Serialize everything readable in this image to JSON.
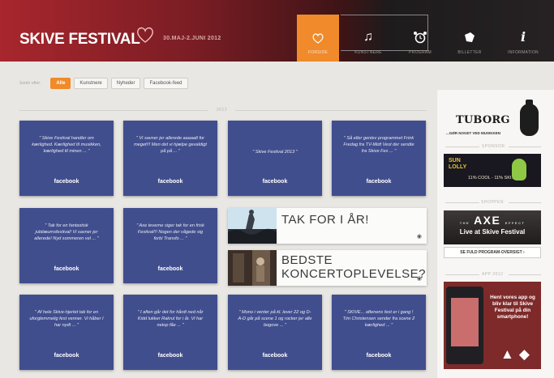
{
  "header": {
    "brand": "SKIVE FESTIVAL",
    "dates": "30.MAJ-2.JUNI 2012",
    "nav": [
      {
        "label": "FORSIDE",
        "icon": "heart-icon"
      },
      {
        "label": "KUNSTNERE",
        "icon": "music-note-icon"
      },
      {
        "label": "PROGRAM",
        "icon": "alarm-clock-icon"
      },
      {
        "label": "BILLETTER",
        "icon": "ticket-icon"
      },
      {
        "label": "INFORMATION",
        "icon": "info-icon"
      }
    ]
  },
  "filters": {
    "label": "Sortér efter:",
    "options": [
      "Alle",
      "Kunstnere",
      "Nyheder",
      "Facebook-feed"
    ]
  },
  "sections": {
    "main": "2012",
    "sponsor": "SPONSOR",
    "shoppen": "SHOPPEN",
    "app": "APP 2012"
  },
  "tiles": [
    {
      "quote": "\" Skive Festival handler om kærlighed. Kærlighed til musikken, kærlighed til minen ... \"",
      "source": "facebook"
    },
    {
      "quote": "\" Vi savner jer allerede aaaaalt for meget!!! Men det vi hjælpe gevaldigt på på ... \"",
      "source": "facebook"
    },
    {
      "quote": "\" Skive Festival 2013 \"",
      "source": "facebook"
    },
    {
      "quote": "\" Så eller genlev programmet Frink Fredag fra TV-Midt Vest der sendte fra Skive Fes ... \"",
      "source": "facebook"
    },
    {
      "quote": "\" Tak for en fantastisk jubilæumsfestival! Vi savner jer allerede! Nyd sommeren vel ... \"",
      "source": "facebook"
    },
    {
      "quote": "\" Axe teverne siger tak for en frisk Festival!!! Nogen der vågede sig forbi Transfo ... \"",
      "source": "facebook"
    },
    {
      "quote": "\" Af hele Skive-hjertet tak for en uforglemmelig fest venner. Vi håber I har nydt ... \"",
      "source": "facebook"
    },
    {
      "quote": "\" I aften går det for hårdt ned når Kidd lukker Rakrul for i år. Vi har netop fåe ... \"",
      "source": "facebook"
    },
    {
      "quote": "\" Mono i venter på kl. lever 22 og D-A-D går på scene 1 og rocker jer alle bogove ... \"",
      "source": "facebook"
    },
    {
      "quote": "\" SKIVE... aftenens fest er i gang ! Tim Christensen sender fra scene 2 kærlighed ... \"",
      "source": "facebook"
    }
  ],
  "news": [
    {
      "title": "TAK FOR I ÅR!",
      "icon": "rss-icon"
    },
    {
      "title_line1": "BEDSTE",
      "title_line2": "KONCERTOPLEVELSE?",
      "icon": "rss-icon"
    }
  ],
  "sidebar": {
    "tuborg": "TUBORG",
    "tuborg_tag": "...GØR NOGET VED MUSIKKEN",
    "sun_lolly_line1": "SUN",
    "sun_lolly_line2": "LOLLY",
    "sun_lolly_copy": "11% COOL - 11% SKI...",
    "axe_small": "THE",
    "axe_brand": "AXE",
    "axe_effect": "EFFECT",
    "axe_live": "Live at Skive Festival",
    "program_link": "SE FULD PROGRAM-OVERSIGT ›",
    "app_text": "Hent vores app og bliv klar til Skive Festival på din smartphone!"
  },
  "colors": {
    "accent": "#f08a2a",
    "tile": "#414e8e",
    "brand_red": "#a8262d"
  }
}
